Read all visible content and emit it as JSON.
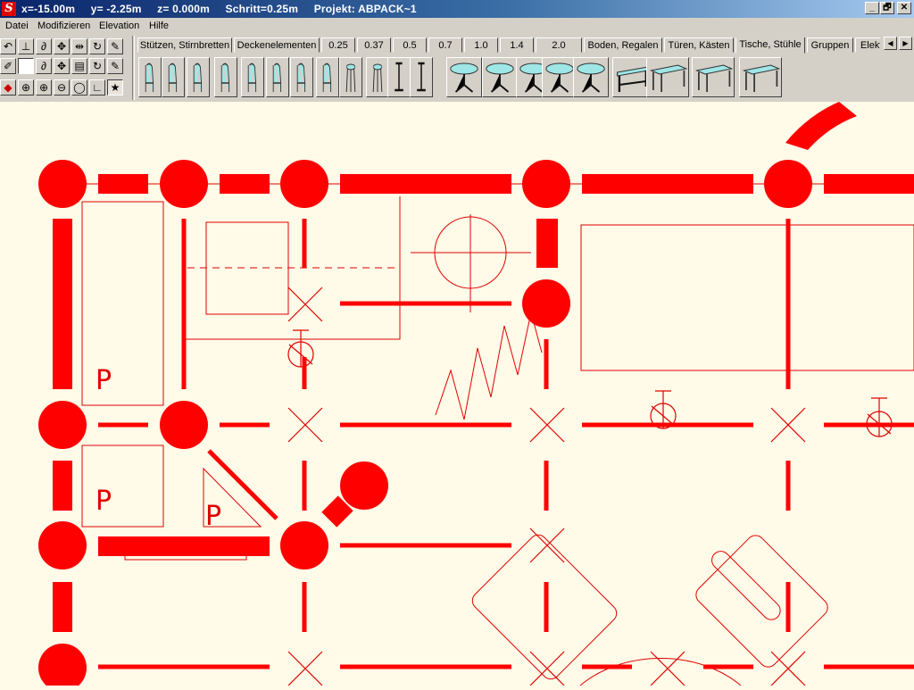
{
  "app": {
    "logo_letter": "S",
    "status": {
      "x": "x=-15.00m",
      "y": "y= -2.25m",
      "z": "z= 0.000m",
      "step": "Schritt=0.25m",
      "project": "Projekt: ABPACK~1"
    }
  },
  "window_controls": [
    "_",
    "🗗",
    "✕"
  ],
  "menu": [
    "Datei",
    "Modifizieren",
    "Elevation",
    "Hilfe"
  ],
  "tabs": [
    "Stützen, Stirnbretten",
    "Deckenelementen",
    "0.25",
    "0.37",
    "0.5",
    "0.7",
    "1.0",
    "1.4",
    "2.0",
    "Boden, Regalen",
    "Türen, Kästen",
    "Tische, Stühle",
    "Gruppen",
    "Elektr"
  ],
  "active_tab": "Tische, Stühle",
  "objects": [
    "chair-icon",
    "chair-icon",
    "chair-icon",
    "chair-icon",
    "chair-icon",
    "chair-icon",
    "chair-icon",
    "chair-icon",
    "stool-icon",
    "stool-icon",
    "high-table-icon",
    "high-table-icon",
    "round-table-icon",
    "round-table-icon",
    "round-table-icon",
    "round-table-icon",
    "round-table-icon",
    "desk-icon",
    "table-icon",
    "table-icon",
    "table-icon",
    "desk-icon"
  ],
  "tool_icons": [
    "undo-icon",
    "dimension-icon",
    "chain-icon",
    "move-icon",
    "measure-icon",
    "rotate-icon",
    "brush-icon",
    "paint-icon",
    "blank-icon",
    "pointer-icon",
    "move-icon",
    "frame-icon",
    "rotate-icon",
    "eraser-icon",
    "layers-icon",
    "zoom-window-icon",
    "zoom-in-icon",
    "zoom-out-icon",
    "zoom-all-icon",
    "angle-icon",
    "wizard-icon"
  ],
  "plan_labels": {
    "p1": "P",
    "p2": "P",
    "p3": "P"
  }
}
